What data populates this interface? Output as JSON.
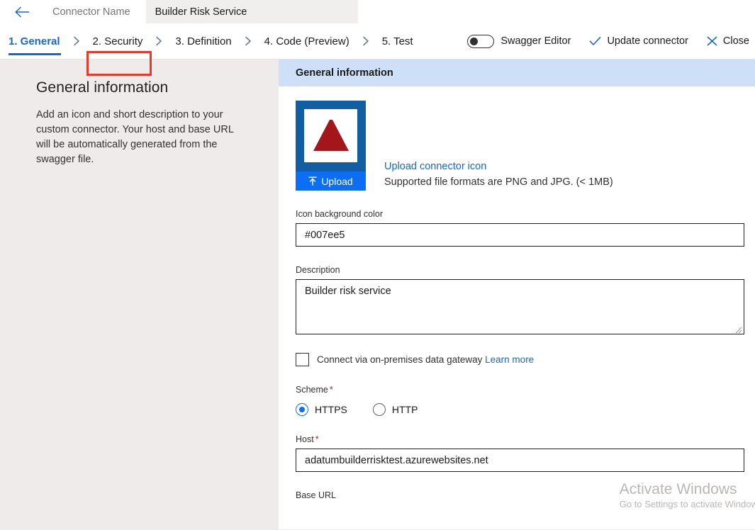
{
  "topbar": {
    "back_icon": "back-arrow-icon",
    "connector_name_label": "Connector Name",
    "connector_name_value": "Builder Risk Service"
  },
  "steps": [
    {
      "label": "1. General",
      "active": true
    },
    {
      "label": "2. Security",
      "active": false
    },
    {
      "label": "3. Definition",
      "active": false
    },
    {
      "label": "4. Code (Preview)",
      "active": false
    },
    {
      "label": "5. Test",
      "active": false
    }
  ],
  "commands": {
    "swagger_toggle_label": "Swagger Editor",
    "swagger_toggle_state": "off",
    "update_label": "Update connector",
    "update_icon": "checkmark-icon",
    "close_label": "Close",
    "close_icon": "close-x-icon"
  },
  "left_pane": {
    "title": "General information",
    "description": "Add an icon and short description to your custom connector. Your host and base URL will be automatically generated from the swagger file."
  },
  "panel": {
    "header": "General information",
    "icon": {
      "upload_button_label": "Upload",
      "upload_icon": "upload-arrow-icon",
      "logo_icon": "adatum-a-logo-icon",
      "link_label": "Upload connector icon",
      "note": "Supported file formats are PNG and JPG. (< 1MB)"
    },
    "fields": {
      "icon_background_color": {
        "label": "Icon background color",
        "value": "#007ee5",
        "required": false
      },
      "description": {
        "label": "Description",
        "value": "Builder risk service",
        "required": false
      },
      "gateway_checkbox": {
        "label": "Connect via on-premises data gateway",
        "link_label": "Learn more",
        "checked": false
      },
      "scheme": {
        "label": "Scheme",
        "required": true,
        "options": [
          {
            "label": "HTTPS",
            "selected": true
          },
          {
            "label": "HTTP",
            "selected": false
          }
        ]
      },
      "host": {
        "label": "Host",
        "value": "adatumbuilderrisktest.azurewebsites.net",
        "required": true
      },
      "base_url": {
        "label": "Base URL",
        "required": false
      }
    }
  },
  "watermark": {
    "title": "Activate Windows",
    "subtitle": "Go to Settings to activate Windows."
  },
  "colors": {
    "accent_blue": "#1267d4",
    "panel_header_blue": "#cde0f7",
    "annotation_red": "#e8392b",
    "upload_blue": "#0b6ef5",
    "icon_card_blue": "#115ea3",
    "page_bg": "#efebeb"
  }
}
